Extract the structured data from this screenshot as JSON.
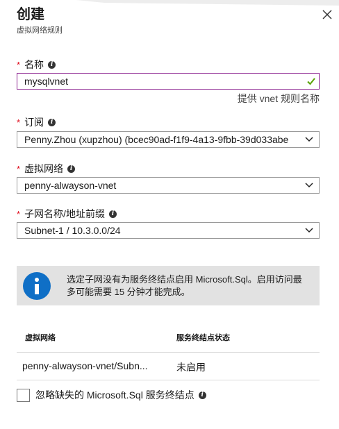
{
  "header": {
    "title": "创建",
    "subtitle": "虚拟网络规则"
  },
  "form": {
    "name": {
      "label": "名称",
      "value": "mysqlvnet",
      "hint": "提供 vnet 规则名称"
    },
    "subscription": {
      "label": "订阅",
      "value": "Penny.Zhou (xupzhou) (bcec90ad-f1f9-4a13-9fbb-39d033abe"
    },
    "vnet": {
      "label": "虚拟网络",
      "value": "penny-alwayson-vnet"
    },
    "subnet": {
      "label": "子网名称/地址前缀",
      "value": "Subnet-1 / 10.3.0.0/24"
    }
  },
  "info_message": "选定子网没有为服务终结点启用 Microsoft.Sql。启用访问最多可能需要 15 分钟才能完成。",
  "table": {
    "headers": [
      "虚拟网络",
      "服务终结点状态"
    ],
    "rows": [
      [
        "penny-alwayson-vnet/Subn...",
        "未启用"
      ]
    ]
  },
  "ignore_checkbox": {
    "label": "忽略缺失的 Microsoft.Sql 服务终结点",
    "checked": false
  },
  "colors": {
    "required": "#e00b1c",
    "active_border": "#8a1f8e",
    "valid_check": "#57a300",
    "info_icon": "#0f6fc6",
    "info_bg": "#e2e2e2"
  }
}
